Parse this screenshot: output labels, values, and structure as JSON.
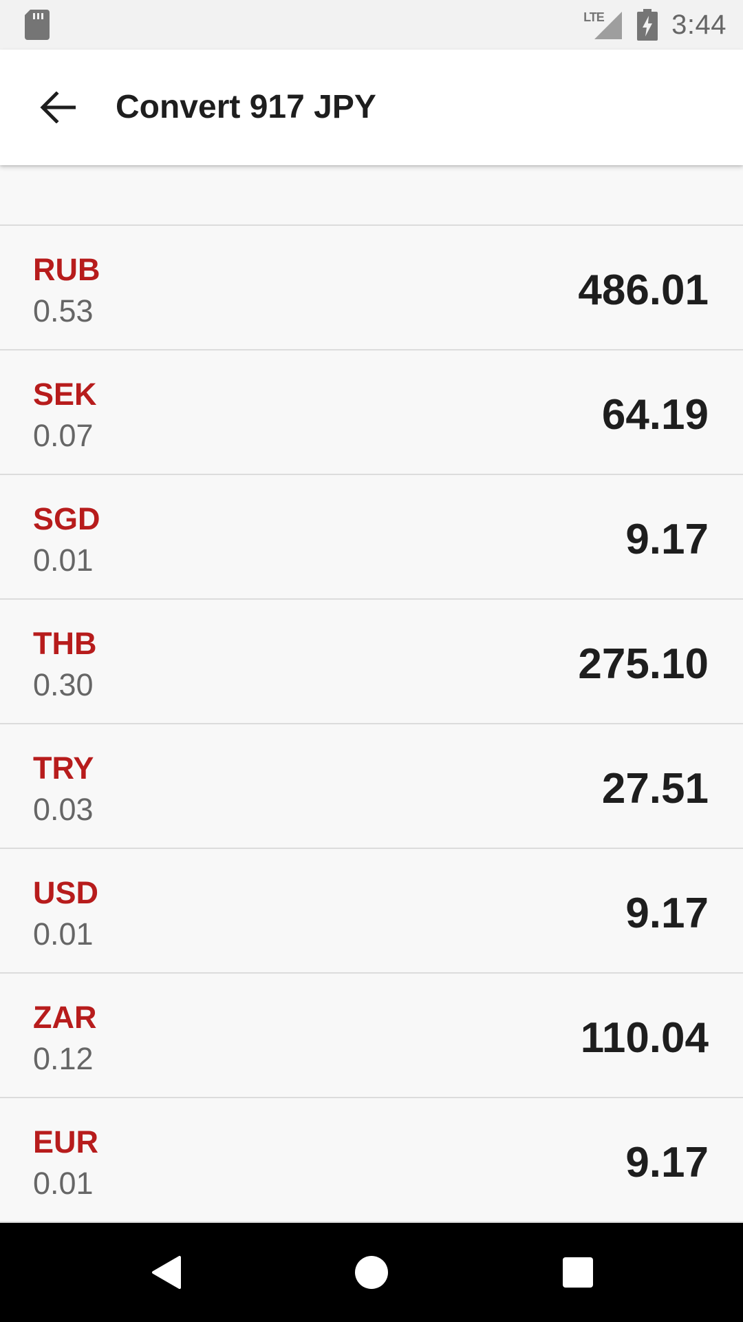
{
  "status_bar": {
    "time": "3:44",
    "network_label": "LTE",
    "icons": [
      "sd-card-icon",
      "lte-signal-icon",
      "battery-charging-icon"
    ]
  },
  "app_bar": {
    "title": "Convert 917 JPY",
    "back_icon": "arrow-back-icon"
  },
  "currencies": [
    {
      "code": "RUB",
      "rate": "0.53",
      "value": "486.01"
    },
    {
      "code": "SEK",
      "rate": "0.07",
      "value": "64.19"
    },
    {
      "code": "SGD",
      "rate": "0.01",
      "value": "9.17"
    },
    {
      "code": "THB",
      "rate": "0.30",
      "value": "275.10"
    },
    {
      "code": "TRY",
      "rate": "0.03",
      "value": "27.51"
    },
    {
      "code": "USD",
      "rate": "0.01",
      "value": "9.17"
    },
    {
      "code": "ZAR",
      "rate": "0.12",
      "value": "110.04"
    },
    {
      "code": "EUR",
      "rate": "0.01",
      "value": "9.17"
    }
  ],
  "nav_bar": {
    "buttons": [
      "nav-back-icon",
      "nav-home-icon",
      "nav-recents-icon"
    ]
  },
  "colors": {
    "accent": "#b71c1c",
    "text_primary": "#1e1e1e",
    "text_secondary": "#666666",
    "background": "#f8f8f8"
  }
}
